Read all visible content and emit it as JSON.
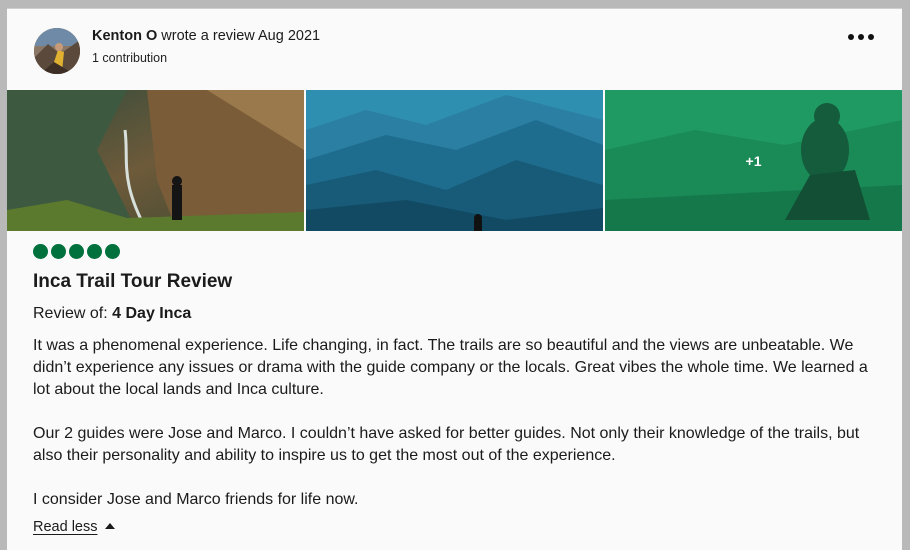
{
  "review": {
    "author": "Kenton O",
    "action": "wrote a review",
    "date": "Aug 2021",
    "contributions": "1 contribution",
    "more_icon": "more-horizontal-icon",
    "photos_extra_count": "+1",
    "rating": 5,
    "rating_color": "#00703c",
    "title": "Inca Trail Tour Review",
    "review_of_label": "Review of:",
    "review_of_value": "4 Day Inca",
    "paragraphs": [
      "It was a phenomenal experience. Life changing, in fact. The trails are so beautiful and the views are unbeatable. We didn’t experience any issues or drama with the guide company or the locals. Great vibes the whole time. We learned a lot about the local lands and Inca culture.",
      "Our 2 guides were Jose and Marco. I couldn’t have asked for better guides. Not only their knowledge of the trails, but also their personality and ability to inspire us to get the most out of the experience.",
      "I consider Jose and Marco friends for life now."
    ],
    "read_less": "Read less"
  }
}
